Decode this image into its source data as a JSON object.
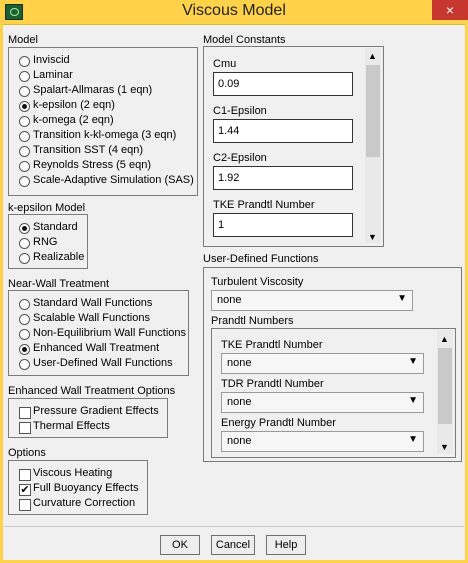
{
  "window": {
    "title": "Viscous Model",
    "close_icon": "×"
  },
  "model": {
    "label": "Model",
    "options": [
      {
        "label": "Inviscid",
        "selected": false
      },
      {
        "label": "Laminar",
        "selected": false
      },
      {
        "label": "Spalart-Allmaras (1 eqn)",
        "selected": false
      },
      {
        "label": "k-epsilon (2 eqn)",
        "selected": true
      },
      {
        "label": "k-omega (2 eqn)",
        "selected": false
      },
      {
        "label": "Transition k-kl-omega (3 eqn)",
        "selected": false
      },
      {
        "label": "Transition SST (4 eqn)",
        "selected": false
      },
      {
        "label": "Reynolds Stress (5 eqn)",
        "selected": false
      },
      {
        "label": "Scale-Adaptive Simulation (SAS)",
        "selected": false
      }
    ]
  },
  "k_epsilon_model": {
    "label": "k-epsilon Model",
    "options": [
      {
        "label": "Standard",
        "selected": true
      },
      {
        "label": "RNG",
        "selected": false
      },
      {
        "label": "Realizable",
        "selected": false
      }
    ]
  },
  "near_wall": {
    "label": "Near-Wall Treatment",
    "options": [
      {
        "label": "Standard Wall Functions",
        "selected": false
      },
      {
        "label": "Scalable Wall Functions",
        "selected": false
      },
      {
        "label": "Non-Equilibrium Wall Functions",
        "selected": false
      },
      {
        "label": "Enhanced Wall Treatment",
        "selected": true
      },
      {
        "label": "User-Defined Wall Functions",
        "selected": false
      }
    ]
  },
  "enhanced_wall": {
    "label": "Enhanced Wall Treatment Options",
    "options": [
      {
        "label": "Pressure Gradient Effects",
        "checked": false
      },
      {
        "label": "Thermal Effects",
        "checked": false
      }
    ]
  },
  "options": {
    "label": "Options",
    "items": [
      {
        "label": "Viscous Heating",
        "checked": false
      },
      {
        "label": "Full Buoyancy Effects",
        "checked": true
      },
      {
        "label": "Curvature Correction",
        "checked": false
      }
    ]
  },
  "model_constants": {
    "label": "Model Constants",
    "fields": [
      {
        "label": "Cmu",
        "value": "0.09"
      },
      {
        "label": "C1-Epsilon",
        "value": "1.44"
      },
      {
        "label": "C2-Epsilon",
        "value": "1.92"
      },
      {
        "label": "TKE Prandtl Number",
        "value": "1"
      }
    ]
  },
  "udf": {
    "label": "User-Defined Functions",
    "turbulent_viscosity": {
      "label": "Turbulent Viscosity",
      "value": "none"
    },
    "prandtl_numbers": {
      "label": "Prandtl Numbers",
      "fields": [
        {
          "label": "TKE Prandtl Number",
          "value": "none"
        },
        {
          "label": "TDR Prandtl Number",
          "value": "none"
        },
        {
          "label": "Energy Prandtl Number",
          "value": "none"
        }
      ]
    }
  },
  "buttons": {
    "ok": "OK",
    "cancel": "Cancel",
    "help": "Help"
  },
  "icons": {
    "scroll_up": "▲",
    "scroll_down": "▼",
    "dropdown": "▼",
    "check": "✔"
  }
}
